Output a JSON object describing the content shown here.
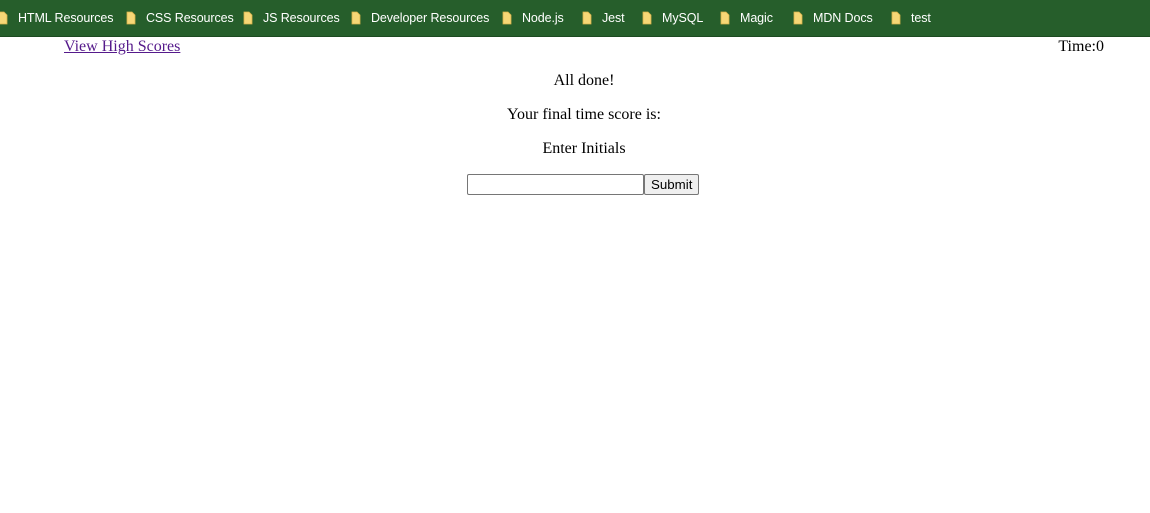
{
  "bookmarks_bar": {
    "background": "#265e2b",
    "folder_icon_color": "#f6d776",
    "items": [
      {
        "label": "HTML Resources",
        "icon": "folder-icon"
      },
      {
        "label": "CSS Resources",
        "icon": "folder-icon"
      },
      {
        "label": "JS Resources",
        "icon": "folder-icon"
      },
      {
        "label": "Developer Resources",
        "icon": "folder-icon"
      },
      {
        "label": "Node.js",
        "icon": "folder-icon"
      },
      {
        "label": "Jest",
        "icon": "folder-icon"
      },
      {
        "label": "MySQL",
        "icon": "folder-icon"
      },
      {
        "label": "Magic",
        "icon": "folder-icon"
      },
      {
        "label": "MDN Docs",
        "icon": "folder-icon"
      },
      {
        "label": "test",
        "icon": "folder-icon"
      }
    ]
  },
  "header": {
    "high_scores_link": "View High Scores",
    "timer_label": "Time:",
    "timer_value": "0"
  },
  "main": {
    "heading": "All done!",
    "final_score_text": "Your final time score is:",
    "initials_label": "Enter Initials",
    "initials_input_value": "",
    "submit_label": "Submit"
  }
}
